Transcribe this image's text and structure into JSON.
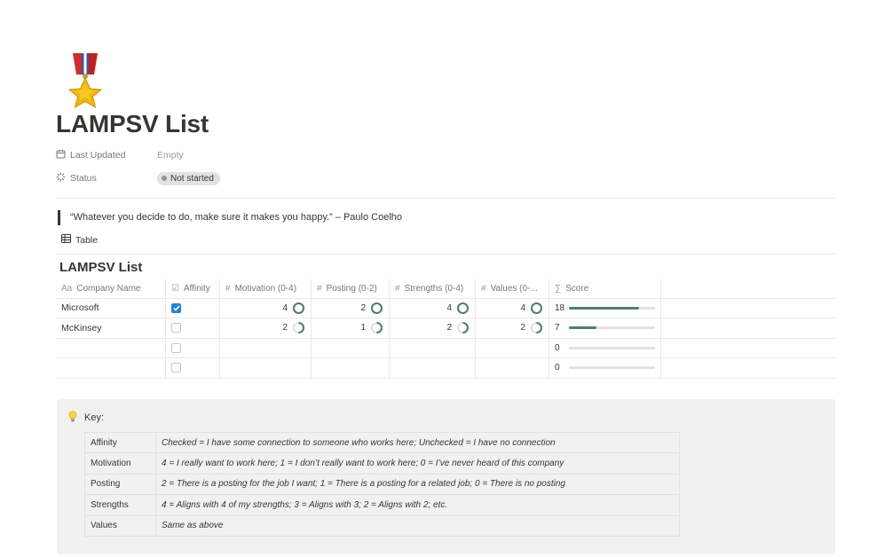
{
  "page": {
    "icon": "military-medal-icon",
    "title": "LAMPSV List"
  },
  "properties": {
    "last_updated": {
      "label": "Last Updated",
      "value": "Empty",
      "icon": "calendar-icon"
    },
    "status": {
      "label": "Status",
      "value": "Not started",
      "icon": "status-spinner-icon"
    }
  },
  "quote": "“Whatever you decide to do, make sure it makes you happy.” – Paulo Coelho",
  "view": {
    "label": "Table",
    "icon": "table-icon"
  },
  "database": {
    "title": "LAMPSV List",
    "columns": {
      "name": "Company Name",
      "affinity": "Affinity",
      "motivation": "Motivation (0-4)",
      "posting": "Posting (0-2)",
      "strengths": "Strengths (0-4)",
      "values": "Values (0-...",
      "score": "Score"
    },
    "rows": [
      {
        "name": "Microsoft",
        "affinity": true,
        "motivation": "4",
        "posting": "2",
        "strengths": "4",
        "values": "4",
        "score": "18"
      },
      {
        "name": "McKinsey",
        "affinity": false,
        "motivation": "2",
        "posting": "1",
        "strengths": "2",
        "values": "2",
        "score": "7"
      },
      {
        "name": "",
        "affinity": false,
        "motivation": "",
        "posting": "",
        "strengths": "",
        "values": "",
        "score": "0"
      },
      {
        "name": "",
        "affinity": false,
        "motivation": "",
        "posting": "",
        "strengths": "",
        "values": "",
        "score": "0"
      }
    ],
    "score_bar": {
      "max": 22,
      "values": [
        18,
        7,
        0,
        0
      ]
    },
    "ring_fractions": {
      "motivation": [
        1.0,
        0.5
      ],
      "posting": [
        1.0,
        0.5
      ],
      "strengths": [
        1.0,
        0.5
      ],
      "values": [
        1.0,
        0.5
      ]
    },
    "colors": {
      "accent_green": "#4e7e6a",
      "checkbox_blue": "#2383e2"
    }
  },
  "callout": {
    "icon": "lightbulb-icon",
    "heading": "Key:",
    "rows": [
      {
        "label": "Affinity",
        "desc": "Checked = I have some connection to someone who works here; Unchecked = I have no connection"
      },
      {
        "label": "Motivation",
        "desc": "4 = I really want to work here; 1 = I don’t really want to work here; 0 = I’ve never heard of this company"
      },
      {
        "label": "Posting",
        "desc": "2 = There is a posting for the job I want; 1 = There is a posting for a related job; 0 = There is no posting"
      },
      {
        "label": "Strengths",
        "desc": "4 = Aligns with 4 of my strengths; 3 = Aligns with 3; 2 = Aligns with 2; etc."
      },
      {
        "label": "Values",
        "desc": "Same as above"
      }
    ]
  }
}
